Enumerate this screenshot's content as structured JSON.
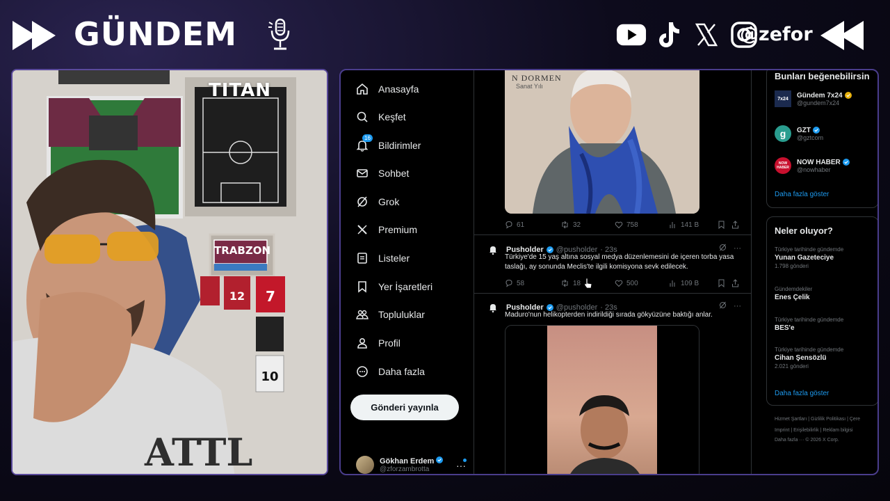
{
  "overlay": {
    "title": "GÜNDEM",
    "handle": "@zefor",
    "social_icons": [
      "youtube-icon",
      "tiktok-icon",
      "x-icon",
      "instagram-icon"
    ],
    "accent": "#5a4a9c"
  },
  "webcam": {
    "sponsor": "TITAN",
    "scarf_text": "TRABZON"
  },
  "sidebar": {
    "items": [
      {
        "label": "Anasayfa",
        "icon": "home-icon"
      },
      {
        "label": "Keşfet",
        "icon": "search-icon"
      },
      {
        "label": "Bildirimler",
        "icon": "bell-icon",
        "badge": "16"
      },
      {
        "label": "Sohbet",
        "icon": "mail-icon"
      },
      {
        "label": "Grok",
        "icon": "grok-icon"
      },
      {
        "label": "Premium",
        "icon": "x-logo-icon"
      },
      {
        "label": "Listeler",
        "icon": "list-icon"
      },
      {
        "label": "Yer İşaretleri",
        "icon": "bookmark-icon"
      },
      {
        "label": "Topluluklar",
        "icon": "people-icon"
      },
      {
        "label": "Profil",
        "icon": "person-icon"
      },
      {
        "label": "Daha fazla",
        "icon": "more-circle-icon"
      }
    ],
    "post_button": "Gönderi yayınla",
    "account": {
      "name": "Gökhan Erdem",
      "handle": "@zforzambrotta"
    }
  },
  "feed": {
    "media_wall_text": "N DORMEN",
    "media_wall_sub": "Sanat Yılı",
    "tweet0_actions": {
      "replies": "61",
      "reposts": "32",
      "likes": "758",
      "views": "141 B"
    },
    "tweets": [
      {
        "name": "Pusholder",
        "handle": "@pusholder",
        "time": "· 23s",
        "text": "Türkiye'de 15 yaş altına sosyal medya düzenlemesini de içeren torba yasa taslağı, ay sonunda Meclis'te ilgili komisyona sevk edilecek.",
        "replies": "58",
        "reposts": "18",
        "likes": "500",
        "views": "109 B"
      },
      {
        "name": "Pusholder",
        "handle": "@pusholder",
        "time": "· 23s",
        "text": "Maduro'nun helikopterden indirildiği sırada gökyüzüne baktığı anlar."
      }
    ]
  },
  "right": {
    "suggest_title": "Bunları beğenebilirsin",
    "suggestions": [
      {
        "name": "Gündem 7x24",
        "handle": "@gundem7x24",
        "logo": "7x24",
        "verified_color": "#e8b10b",
        "logo_bg": "#1b2a4e"
      },
      {
        "name": "GZT",
        "handle": "@gztcom",
        "logo": "g",
        "verified_color": "#1d9bf0",
        "logo_bg": "#2a9d8f"
      },
      {
        "name": "NOW HABER",
        "handle": "@nowhaber",
        "logo": "NOW HABER",
        "verified_color": "#1d9bf0",
        "logo_bg": "#c8102e"
      }
    ],
    "show_more": "Daha fazla göster",
    "trends_title": "Neler oluyor?",
    "trends": [
      {
        "ctx": "Türkiye tarihinde gündemde",
        "name": "Yunan Gazeteciye",
        "count": "1.798 gönderi"
      },
      {
        "ctx": "Gündemdekiler",
        "name": "Enes Çelik",
        "count": ""
      },
      {
        "ctx": "Türkiye tarihinde gündemde",
        "name": "BES'e",
        "count": ""
      },
      {
        "ctx": "Türkiye tarihinde gündemde",
        "name": "Cihan Şensözlü",
        "count": "2.021 gönderi"
      }
    ],
    "show_more2": "Daha fazla göster",
    "footer": [
      "Hizmet Şartları  |  Gizlilik Politikası  |  Çere",
      "Imprint  |  Erişilebilirlik  |  Reklam bilgisi",
      "Daha fazla ···  © 2026 X Corp."
    ]
  }
}
